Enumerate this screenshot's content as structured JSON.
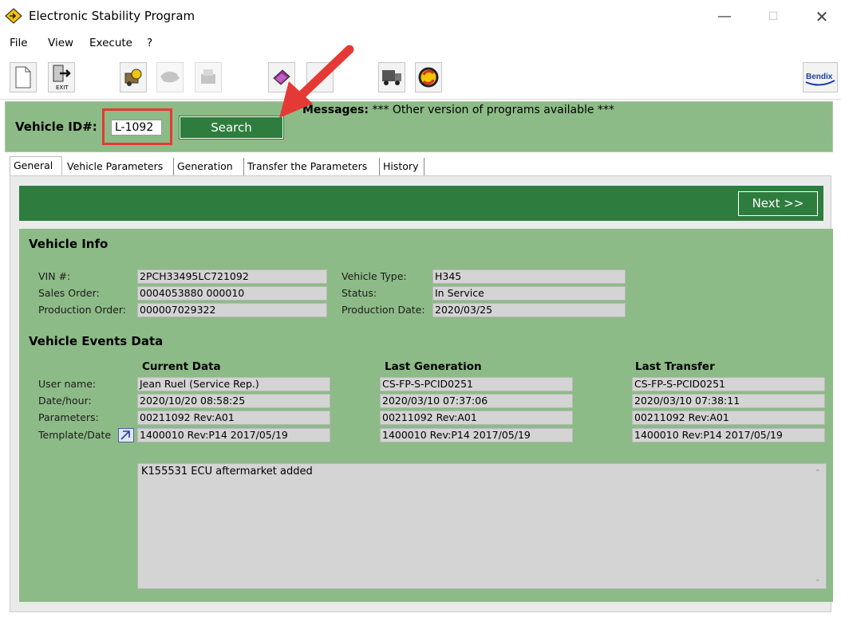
{
  "window": {
    "title": "Electronic Stability Program",
    "minimize": "—",
    "maximize": "☐",
    "close": "✕"
  },
  "menu": [
    "File",
    "View",
    "Execute",
    "?"
  ],
  "toolbar": {
    "icons": [
      "new-document-icon",
      "exit-icon",
      "vehicle-gears-icon",
      "disabled-tool-icon",
      "disabled-printer-icon",
      "book-icon",
      "pencil-icon",
      "truck-icon",
      "refresh-sync-icon",
      "bendix-logo"
    ],
    "exit_label": "EXIT",
    "brand": "Bendix"
  },
  "search": {
    "label": "Vehicle ID#:",
    "value": "L-1092",
    "button": "Search",
    "messages_label": "Messages:",
    "messages_text": "*** Other version of programs available ***"
  },
  "tabs": [
    "General",
    "Vehicle Parameters",
    "Generation",
    "Transfer the Parameters",
    "History"
  ],
  "nav": {
    "next": "Next >>"
  },
  "vehicle_info": {
    "heading": "Vehicle Info",
    "vin_label": "VIN #:",
    "vin": "2PCH33495LC721092",
    "sales_order_label": "Sales Order:",
    "sales_order": "0004053880 000010",
    "production_order_label": "Production Order:",
    "production_order": "000007029322",
    "vehicle_type_label": "Vehicle Type:",
    "vehicle_type": "H345",
    "status_label": "Status:",
    "status": "In Service",
    "production_date_label": "Production Date:",
    "production_date": "2020/03/25"
  },
  "events": {
    "heading": "Vehicle Events Data",
    "row_labels": [
      "User name:",
      "Date/hour:",
      "Parameters:",
      "Template/Date"
    ],
    "columns": [
      {
        "heading": "Current Data",
        "values": [
          "Jean Ruel (Service Rep.)",
          "2020/10/20 08:58:25",
          "00211092 Rev:A01",
          "1400010 Rev:P14 2017/05/19"
        ]
      },
      {
        "heading": "Last Generation",
        "values": [
          "CS-FP-S-PCID0251",
          "2020/03/10 07:37:06",
          "00211092 Rev:A01",
          "1400010 Rev:P14 2017/05/19"
        ]
      },
      {
        "heading": "Last Transfer",
        "values": [
          "CS-FP-S-PCID0251",
          "2020/03/10 07:38:11",
          "00211092 Rev:A01",
          "1400010 Rev:P14 2017/05/19"
        ]
      }
    ],
    "notes": "K155531 ECU aftermarket added"
  },
  "colors": {
    "panel_green": "#8dbb87",
    "dark_green": "#2e7d3e",
    "highlight_red": "#e53935",
    "field_gray": "#d4d4d4"
  }
}
